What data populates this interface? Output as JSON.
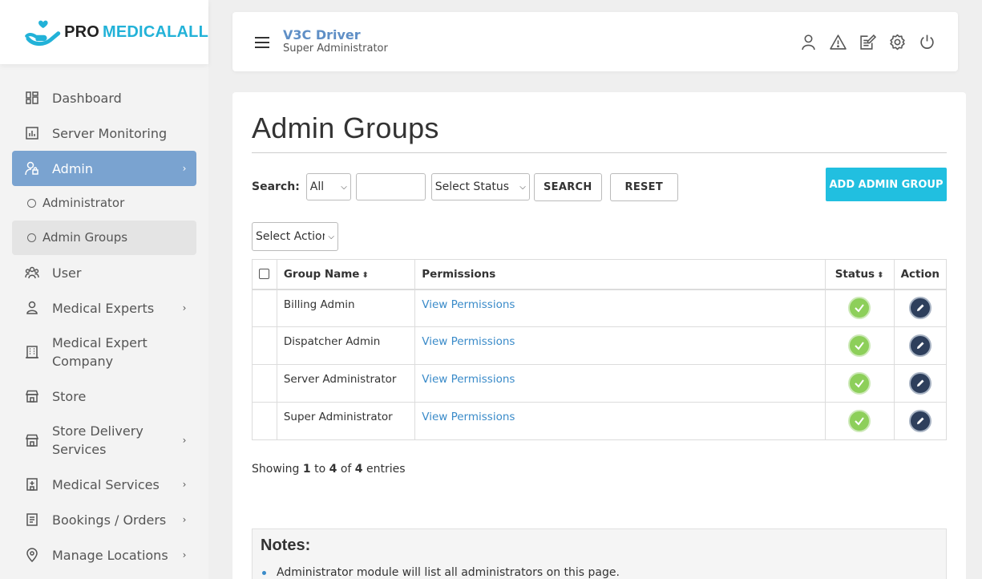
{
  "logo": {
    "pro": "PRO",
    "medicalall": "MEDICALALL"
  },
  "sidebar": {
    "items": [
      {
        "label": "Dashboard",
        "icon": "dashboard-icon",
        "chevron": false
      },
      {
        "label": "Server Monitoring",
        "icon": "chart-icon",
        "chevron": false
      },
      {
        "label": "Admin",
        "icon": "admin-user-icon",
        "chevron": true,
        "active": true
      },
      {
        "label": "Administrator",
        "icon": "circle-icon",
        "sub": true
      },
      {
        "label": "Admin Groups",
        "icon": "circle-icon",
        "sub": true,
        "selected": true
      },
      {
        "label": "User",
        "icon": "users-icon",
        "chevron": false
      },
      {
        "label": "Medical Experts",
        "icon": "person-icon",
        "chevron": true
      },
      {
        "label": "Medical Expert Company",
        "icon": "building-icon",
        "chevron": false
      },
      {
        "label": "Store",
        "icon": "store-icon",
        "chevron": false
      },
      {
        "label": "Store Delivery Services",
        "icon": "store-icon",
        "chevron": true
      },
      {
        "label": "Medical Services",
        "icon": "hospital-icon",
        "chevron": true
      },
      {
        "label": "Bookings / Orders",
        "icon": "list-icon",
        "chevron": true
      },
      {
        "label": "Manage Locations",
        "icon": "location-icon",
        "chevron": true
      }
    ]
  },
  "header": {
    "app_name": "V3C Driver",
    "role": "Super Administrator",
    "icons": [
      "user-icon",
      "warning-icon",
      "edit-note-icon",
      "settings-icon",
      "power-icon"
    ]
  },
  "page": {
    "title": "Admin Groups",
    "search_label": "Search:",
    "search_filter_value": "All",
    "search_input_value": "",
    "status_select_value": "Select Status",
    "search_button": "SEARCH",
    "reset_button": "RESET",
    "add_button": "ADD ADMIN GROUP",
    "action_select_value": "Select Action"
  },
  "table": {
    "headers": {
      "group_name": "Group Name",
      "permissions": "Permissions",
      "status": "Status",
      "action": "Action"
    },
    "rows": [
      {
        "group_name": "Billing Admin",
        "permissions": "View Permissions"
      },
      {
        "group_name": "Dispatcher Admin",
        "permissions": "View Permissions"
      },
      {
        "group_name": "Server Administrator",
        "permissions": "View Permissions"
      },
      {
        "group_name": "Super Administrator",
        "permissions": "View Permissions"
      }
    ]
  },
  "pagination": {
    "prefix": "Showing",
    "from": "1",
    "to_word": "to",
    "to": "4",
    "of_word": "of",
    "total": "4",
    "suffix": "entries"
  },
  "notes": {
    "title": "Notes:",
    "items": [
      "Administrator module will list all administrators on this page."
    ]
  },
  "colors": {
    "accent": "#21bfe0",
    "active_menu": "#7aa3d0",
    "link": "#3a8bc9",
    "status_ok": "#8dcf5a",
    "edit": "#2e3f5c"
  }
}
